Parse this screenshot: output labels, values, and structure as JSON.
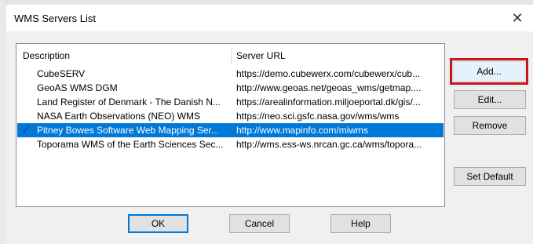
{
  "dialog": {
    "title": "WMS Servers List",
    "close_glyph": "✕"
  },
  "list": {
    "columns": [
      "Description",
      "Server URL"
    ],
    "rows": [
      {
        "description": "CubeSERV",
        "url": "https://demo.cubewerx.com/cubewerx/cub...",
        "selected": false
      },
      {
        "description": "GeoAS WMS DGM",
        "url": "http://www.geoas.net/geoas_wms/getmap....",
        "selected": false
      },
      {
        "description": "Land Register of Denmark - The Danish N...",
        "url": "https://arealinformation.miljoeportal.dk/gis/...",
        "selected": false
      },
      {
        "description": "NASA Earth Observations (NEO) WMS",
        "url": "https://neo.sci.gsfc.nasa.gov/wms/wms",
        "selected": false
      },
      {
        "description": "Pitney Bowes Software Web Mapping Ser...",
        "url": "http://www.mapinfo.com/miwms",
        "selected": true,
        "default_check": "✓"
      },
      {
        "description": "Toporama WMS of the Earth Sciences Sec...",
        "url": "http://wms.ess-ws.nrcan.gc.ca/wms/topora...",
        "selected": false
      }
    ]
  },
  "buttons": {
    "add": "Add...",
    "edit": "Edit...",
    "remove": "Remove",
    "set_default": "Set Default",
    "ok": "OK",
    "cancel": "Cancel",
    "help": "Help"
  },
  "colors": {
    "selection": "#0078d7",
    "highlight_outline": "#c8161d"
  }
}
